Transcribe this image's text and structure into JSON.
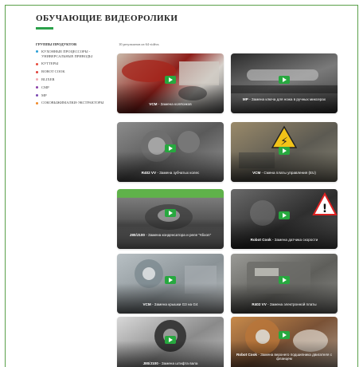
{
  "page": {
    "title": "ОБУЧАЮЩИЕ ВИДЕОРОЛИКИ"
  },
  "sidebar": {
    "heading": "ГРУППЫ ПРОДУКТОВ",
    "items": [
      {
        "label": "КУХОННЫЕ ПРОЦЕССОРЫ - УНИВЕРСАЛЬНЫЕ ПРИВОДЫ",
        "color": "#2a9fd6"
      },
      {
        "label": "КУТТЕРЫ",
        "color": "#e84a3c"
      },
      {
        "label": "ROBOT COOK",
        "color": "#e0403a"
      },
      {
        "label": "BLIXER",
        "color": "#f0a8b0"
      },
      {
        "label": "CMP",
        "color": "#8a3fa8"
      },
      {
        "label": "MP",
        "color": "#7a48b0"
      },
      {
        "label": "СОКОВЫЖИМАЛКИ-ЭКСТРАКТОРЫ",
        "color": "#f08a2a"
      }
    ]
  },
  "results": {
    "count_text": "10 результатов из 64 vidéos"
  },
  "accent_color": "#27a83f",
  "videos": [
    {
      "model": "VCM",
      "sep": " - ",
      "title": "Замена колёсиков"
    },
    {
      "model": "MP",
      "sep": " - ",
      "title": "Замена ключа для ножа в ручных миксерах"
    },
    {
      "model": "R402 VV",
      "sep": " - ",
      "title": "Замена зубчатых колес"
    },
    {
      "model": "VCM",
      "sep": " - ",
      "title": "Смена платы управления (EU)"
    },
    {
      "model": "J80/J100",
      "sep": " - ",
      "title": "Замена конденсатора и реле \"Klixon\""
    },
    {
      "model": "Robot Cook",
      "sep": " - ",
      "title": "Замена датчика скорости"
    },
    {
      "model": "VCM",
      "sep": " - ",
      "title": "Замена крышки G3 на G4"
    },
    {
      "model": "R402 VV",
      "sep": " - ",
      "title": "Замена электронной платы"
    },
    {
      "model": "J80/J100",
      "sep": " - ",
      "title": "Замена штифта вала"
    },
    {
      "model": "Robot Cook",
      "sep": " - ",
      "title": "Замена верхнего подшипника двигателя с фланцем"
    }
  ],
  "icons": {
    "play": "play-icon",
    "warning": "warning-sign-icon"
  }
}
